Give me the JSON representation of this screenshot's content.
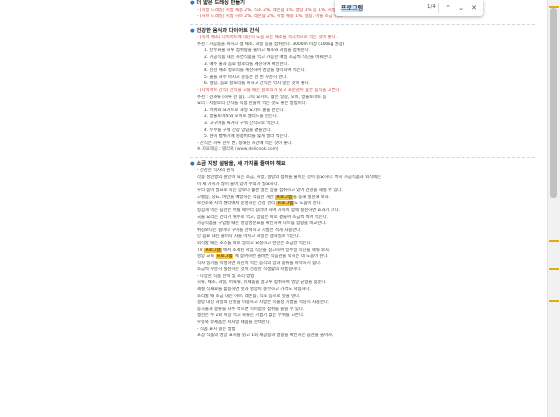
{
  "find_bar": {
    "query": "프로그램",
    "count": "1/4",
    "prev_icon": "⌃",
    "next_icon": "⌄",
    "close_icon": "✕"
  },
  "sections": [
    {
      "header": "더 얇은 드레싱 만들기",
      "lines": [
        {
          "text": "- [지방 드레싱] 지방 채용 2%, 식초 2%, 레몬즙 1%, 설탕 1% 등 1%, 지방도.",
          "red": true,
          "indent": 1
        },
        {
          "text": "- [허브 드레싱] 지방 허브 2%, 레몬즙 2%, 지방 채용 1%, 설탕, 마늘 소금 허브.",
          "red": true,
          "indent": 1
        }
      ]
    },
    {
      "header": "건강한 음식과 다이어트 간식",
      "lines": [
        {
          "text": "- [녹색 채소] 다이어트에 대단히 도움 되는 채소를 적극적으로 먹는 것이 좋다.",
          "red": true,
          "indent": 1
        },
        {
          "text": "추천 : 가공품을 피하고 생 채소, 과일 등을 섭취한다. 3000m 이상 (100kg 권장)",
          "indent": 1
        },
        {
          "text": "1. 탄수화물 하루 섭취량을 줄이고 채소와 과일을 섭취한다.",
          "indent": 2
        },
        {
          "text": "2. 가공식품 대신 자연식품을 먹고 가능한 매일 조금씩 식단을 바꿔본다.",
          "indent": 2
        },
        {
          "text": "3. 매주 물과 음료 칼로리를 계산하여 확인한다.",
          "indent": 2
        },
        {
          "text": "4. 신선 채소 칼로리를 계산하여 영양을 생각하여 먹는다.",
          "indent": 2
        },
        {
          "text": "5. 물을 자주 마시고 운동은 한 번 꾸준히 한다.",
          "indent": 2
        },
        {
          "text": "6. 설탕, 음료 칼로리를 피하고 간식은 먹지 않는 것이 좋다.",
          "indent": 2
        },
        {
          "text": "- [다이어트 간식] 간식을 고를 때는 칼로리가 낮고 포만감이 높은 음식을 고른다.",
          "red": true,
          "indent": 1
        },
        {
          "text": "추천 : 견과류 (하루 한 줌), 그릭 요거트, 삶은 달걀, 오이, 방울토마토 등",
          "indent": 1
        },
        {
          "text": "요리 : 저칼로리 간식을 직접 만들어 먹는 것도 좋은 방법이다.",
          "indent": 1
        },
        {
          "text": "1. 키위와 요거트로 과일 요거트 볼을 만든다.",
          "indent": 2
        },
        {
          "text": "2. 방울토마토와 오이로 샐러드를 만든다.",
          "indent": 2
        },
        {
          "text": "3. 고구마를 찌거나 구워 간식으로 먹는다.",
          "indent": 2
        },
        {
          "text": "4. 두부를 구워 간장 양념을 곁들인다.",
          "indent": 2
        },
        {
          "text": "5. 현미 뻥튀기에 땅콩버터를 얇게 발라 먹는다.",
          "indent": 2
        },
        {
          "text": "- 간식은 하루 한두 번, 정해진 시간에 먹는 것이 좋다.",
          "indent": 1
        }
      ],
      "source": "※ 자료제공 : 델리쿡 (www.delicook.com)"
    },
    {
      "header": "소금 지방 설탕을, 세 가지를 줄여야 해요",
      "lines": [
        {
          "text": "- 건강한 식사의 원칙",
          "indent": 1
        },
        {
          "text": "각종 성인병의 원인이 되는 소금, 지방, 설탕의 섭취를 줄이는 것이 중요하다. 특히 가공식품과 외식에는",
          "indent": 1
        },
        {
          "text": "이 세 가지가 많이 들어 있어 주의가 필요하다.",
          "indent": 1
        },
        {
          "text": "우리 몸이 필요로 하는 양보다 훨씬 많은 양을 섭취하고 있어 건강을 해칠 수 있다.",
          "indent": 1
        },
        {
          "text": "고혈압, 당뇨, 비만을 예방하는 식습관 개선 프로그램을 통해 실천해 보자.",
          "indent": 1,
          "hl": "프로그램"
        },
        {
          "text": "보건소와 지역 센터에서 운영하는 건강 관리 프로그램도 도움이 된다.",
          "indent": 1,
          "hl": "프로그램"
        },
        {
          "text": "싱겁게 먹는 습관은 어릴 때부터 길러야 하며 가족이 함께 실천하면 효과가 크다.",
          "indent": 1
        },
        {
          "text": "국물 요리는 건더기 위주로 먹고, 양념은 따로 곁들여 조금씩 찍어 먹는다.",
          "indent": 1
        },
        {
          "text": "가공식품을 구입할 때는 영양성분표를 확인하여 나트륨 함량을 비교한다.",
          "indent": 1
        },
        {
          "text": "튀김보다는 찜이나 구이를 선택하고 기름은 적게 사용한다.",
          "indent": 1
        },
        {
          "text": "단 음료 대신 물이나 차를 마시고 과일은 생과일로 먹는다.",
          "indent": 1
        },
        {
          "text": "외식할 때는 소스를 따로 달라고 요청하고 반찬은 조금만 먹는다.",
          "indent": 1
        },
        {
          "text": "TV 프로그램 에서 소개된 저염 식단을 참고하여 일주일 식단을 세워 보자.",
          "indent": 1,
          "hl": "프로그램"
        },
        {
          "text": "영양 교육 프로그램 에 참여하면 올바른 식습관을 익히는 데 도움이 된다.",
          "indent": 1,
          "hl": "프로그램"
        },
        {
          "text": "식사 일기를 작성하면 자신이 먹는 음식의 양과 종류를 파악하기 쉽다.",
          "indent": 1
        },
        {
          "text": "조금씩 꾸준히 실천하는 것이 건강한 식생활의 지름길이다.",
          "indent": 1
        },
        {
          "text": "- 다양한 식품 선택 및 조리 방법",
          "indent": 1
        },
        {
          "text": "곡류, 채소, 과일, 어육류, 유제품을 골고루 섭취하여 영양 균형을 맞춘다.",
          "indent": 1
        },
        {
          "text": "제철 식재료를 활용하면 맛과 영양이 풍부하고 가격도 저렴하다.",
          "indent": 1
        },
        {
          "text": "조리할 때 소금 대신 허브, 레몬즙, 식초 등으로 맛을 낸다.",
          "indent": 1
        },
        {
          "text": "설탕 대신 과일의 단맛을 이용하고 지방은 식물성 기름을 적당히 사용한다.",
          "indent": 1
        },
        {
          "text": "통곡물과 콩류를 자주 먹으면 식이섬유 섭취를 늘릴 수 있다.",
          "indent": 1
        },
        {
          "text": "생선은 주 2회 이상 먹고 육류는 기름기 없는 부위를 고른다.",
          "indent": 1
        },
        {
          "text": "우유와 유제품은 저지방 제품을 선택한다.",
          "indent": 1
        },
        {
          "text": "- 식품 표시 읽는 방법",
          "indent": 1
        },
        {
          "text": "포장 식품의 영양 표시를 읽고 1회 제공량과 열량을 확인하는 습관을 들이자.",
          "indent": 1
        }
      ]
    }
  ]
}
